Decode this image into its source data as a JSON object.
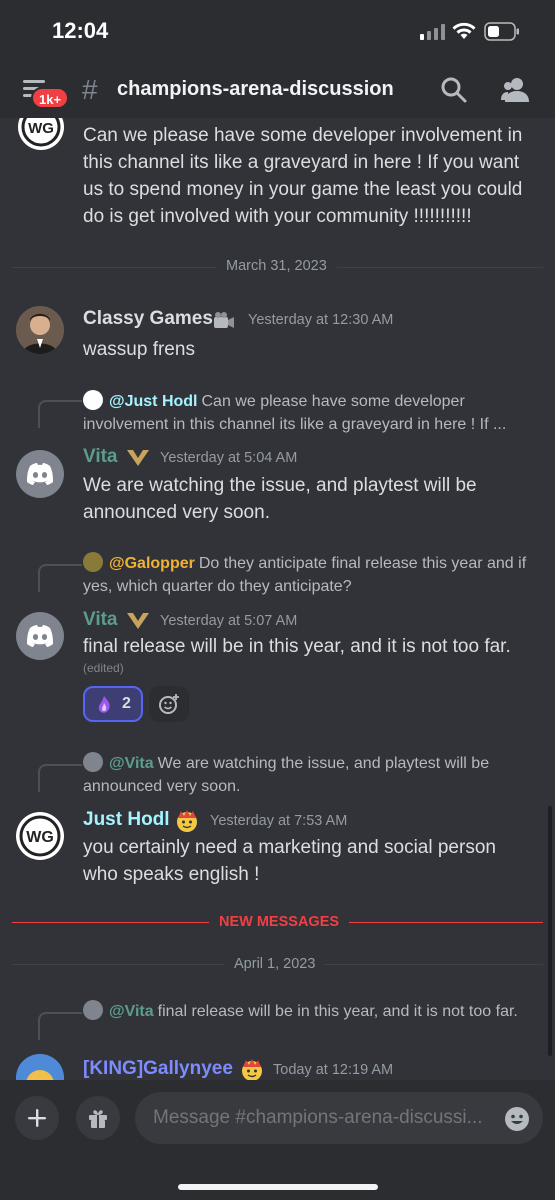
{
  "status_bar": {
    "time": "12:04"
  },
  "header": {
    "badge": "1k+",
    "hash": "#",
    "channel": "champions-arena-discussion"
  },
  "messages": {
    "top_text": "Can we please have some developer involvement in this channel its like a graveyard in here ! If you want us to spend money in your game the least you could do is get involved with your community !!!!!!!!!!!",
    "date1": "March 31, 2023",
    "classy": {
      "username": "Classy Games",
      "timestamp": "Yesterday at 12:30 AM",
      "text": "wassup frens"
    },
    "vita1": {
      "reply_name": "@Just Hodl",
      "reply_text": "Can we please have some developer involvement in this channel its like a graveyard in here ! If ...",
      "username": "Vita",
      "timestamp": "Yesterday at 5:04 AM",
      "text": "We are watching the issue, and playtest will be announced very soon."
    },
    "vita2": {
      "reply_name": "@Galopper",
      "reply_text": "Do they anticipate final release this year and if yes, which quarter do they anticipate?",
      "username": "Vita",
      "timestamp": "Yesterday at 5:07 AM",
      "text": "final release will be in this year, and it is not too far.",
      "edited": "(edited)",
      "reaction_count": "2"
    },
    "hodl": {
      "reply_name": "@Vita",
      "reply_text": "We are watching the issue, and playtest will be announced very soon.",
      "username": "Just Hodl",
      "timestamp": "Yesterday at 7:53 AM",
      "text": "you certainly need a marketing and social person who speaks english !"
    },
    "new_messages": "NEW MESSAGES",
    "date2": "April 1, 2023",
    "king": {
      "reply_name": "@Vita",
      "reply_text": "final release will be in this year, and it is not too far.",
      "username": "[KING]Gallynyee",
      "timestamp": "Today at 12:19 AM"
    }
  },
  "composer": {
    "placeholder": "Message #champions-arena-discussi..."
  },
  "colors": {
    "classy_name": "#f0b232",
    "vita_name": "#5c9c8f",
    "hodl_name": "#a5f3ff",
    "king_name": "#7c8cff",
    "galopper_name": "#f0b232"
  },
  "icons": [
    "menu-icon",
    "search-icon",
    "members-icon",
    "plus-icon",
    "gift-icon",
    "emoji-icon",
    "discord-logo-icon",
    "wg-logo-icon",
    "camera-icon",
    "vita-badge-icon",
    "reaction-icon",
    "add-reaction-icon"
  ]
}
